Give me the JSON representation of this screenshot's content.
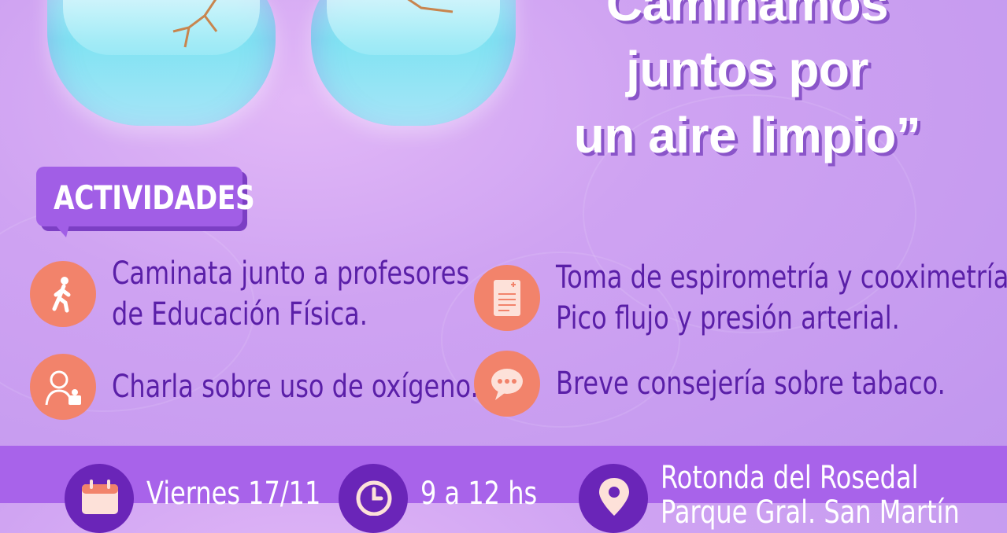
{
  "title": {
    "line1": "Caminamos",
    "line2": "juntos por",
    "line3": "un aire limpio”"
  },
  "badge": {
    "label": "ACTIVIDADES"
  },
  "activities": [
    {
      "icon": "walking-person-icon",
      "lines": [
        "Caminata junto a profesores",
        "de Educación Física."
      ]
    },
    {
      "icon": "oxygen-person-icon",
      "lines": [
        "Charla sobre uso de oxígeno."
      ]
    },
    {
      "icon": "medical-document-icon",
      "lines": [
        "Toma de espirometría y cooximetría.",
        "Pico flujo y presión arterial."
      ]
    },
    {
      "icon": "chat-bubble-icon",
      "lines": [
        "Breve consejería sobre tabaco."
      ]
    }
  ],
  "footer": {
    "date": {
      "icon": "calendar-icon",
      "text": "Viernes 17/11"
    },
    "time": {
      "icon": "clock-icon",
      "text": "9 a 12 hs"
    },
    "place": {
      "icon": "location-pin-icon",
      "line1": "Rotonda del Rosedal",
      "line2": "Parque Gral. San Martín"
    }
  },
  "colors": {
    "background": "#c79cf0",
    "accent_purple": "#a15ee6",
    "icon_circle": "#f2836b",
    "text_purple": "#5a1fa8",
    "footer_bar": "#a863ea",
    "footer_circle": "#6a25b8"
  }
}
